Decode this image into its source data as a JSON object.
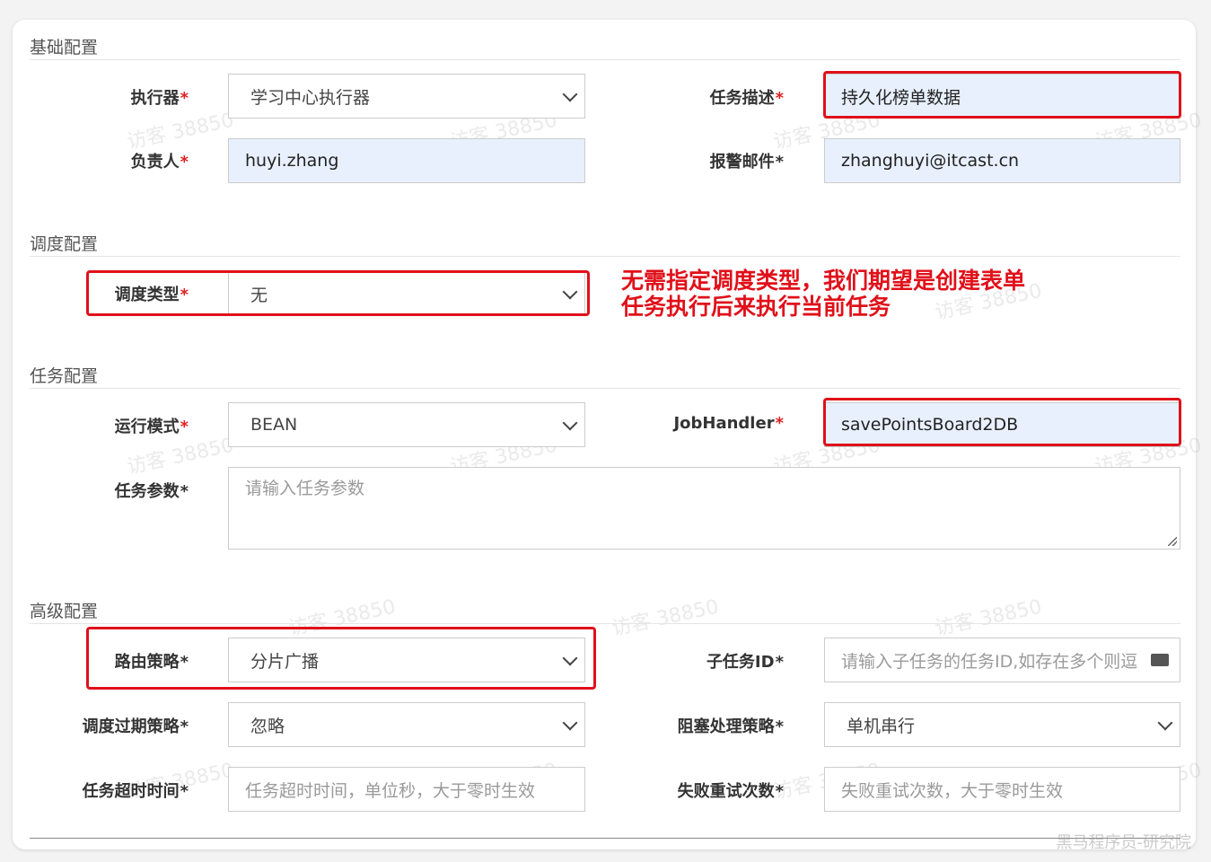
{
  "sections": {
    "basic": "基础配置",
    "schedule": "调度配置",
    "task": "任务配置",
    "advanced": "高级配置"
  },
  "basic": {
    "executor_label": "执行器",
    "executor_value": "学习中心执行器",
    "desc_label": "任务描述",
    "desc_value": "持久化榜单数据",
    "owner_label": "负责人",
    "owner_value": "huyi.zhang",
    "email_label": "报警邮件",
    "email_value": "zhanghuyi@itcast.cn"
  },
  "schedule": {
    "type_label": "调度类型",
    "type_value": "无"
  },
  "annotation": {
    "line1": "无需指定调度类型，我们期望是创建表单",
    "line2": "任务执行后来执行当前任务"
  },
  "task": {
    "mode_label": "运行模式",
    "mode_value": "BEAN",
    "handler_label": "JobHandler",
    "handler_value": "savePointsBoard2DB",
    "params_label": "任务参数",
    "params_placeholder": "请输入任务参数"
  },
  "advanced": {
    "route_label": "路由策略",
    "route_value": "分片广播",
    "child_label": "子任务ID",
    "child_placeholder": "请输入子任务的任务ID,如存在多个则逗",
    "misfire_label": "调度过期策略",
    "misfire_value": "忽略",
    "block_label": "阻塞处理策略",
    "block_value": "单机串行",
    "timeout_label": "任务超时时间",
    "timeout_placeholder": "任务超时时间，单位秒，大于零时生效",
    "retry_label": "失败重试次数",
    "retry_placeholder": "失败重试次数，大于零时生效"
  },
  "required_mark": "*",
  "watermark": "访客 38850",
  "credit": "黑马程序员-研究院",
  "colors": {
    "required": "#dd2222",
    "annotation_red": "#e0101a",
    "filled_bg": "#e8f0fe"
  }
}
